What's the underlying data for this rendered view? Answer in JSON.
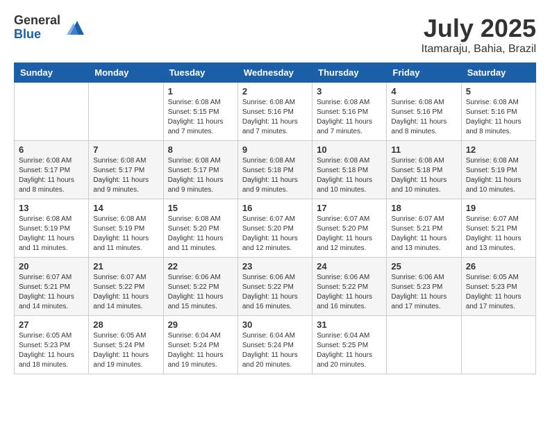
{
  "logo": {
    "general": "General",
    "blue": "Blue"
  },
  "title": {
    "month": "July 2025",
    "location": "Itamaraju, Bahia, Brazil"
  },
  "headers": [
    "Sunday",
    "Monday",
    "Tuesday",
    "Wednesday",
    "Thursday",
    "Friday",
    "Saturday"
  ],
  "weeks": [
    [
      {
        "day": "",
        "info": ""
      },
      {
        "day": "",
        "info": ""
      },
      {
        "day": "1",
        "info": "Sunrise: 6:08 AM\nSunset: 5:15 PM\nDaylight: 11 hours and 7 minutes."
      },
      {
        "day": "2",
        "info": "Sunrise: 6:08 AM\nSunset: 5:16 PM\nDaylight: 11 hours and 7 minutes."
      },
      {
        "day": "3",
        "info": "Sunrise: 6:08 AM\nSunset: 5:16 PM\nDaylight: 11 hours and 7 minutes."
      },
      {
        "day": "4",
        "info": "Sunrise: 6:08 AM\nSunset: 5:16 PM\nDaylight: 11 hours and 8 minutes."
      },
      {
        "day": "5",
        "info": "Sunrise: 6:08 AM\nSunset: 5:16 PM\nDaylight: 11 hours and 8 minutes."
      }
    ],
    [
      {
        "day": "6",
        "info": "Sunrise: 6:08 AM\nSunset: 5:17 PM\nDaylight: 11 hours and 8 minutes."
      },
      {
        "day": "7",
        "info": "Sunrise: 6:08 AM\nSunset: 5:17 PM\nDaylight: 11 hours and 9 minutes."
      },
      {
        "day": "8",
        "info": "Sunrise: 6:08 AM\nSunset: 5:17 PM\nDaylight: 11 hours and 9 minutes."
      },
      {
        "day": "9",
        "info": "Sunrise: 6:08 AM\nSunset: 5:18 PM\nDaylight: 11 hours and 9 minutes."
      },
      {
        "day": "10",
        "info": "Sunrise: 6:08 AM\nSunset: 5:18 PM\nDaylight: 11 hours and 10 minutes."
      },
      {
        "day": "11",
        "info": "Sunrise: 6:08 AM\nSunset: 5:18 PM\nDaylight: 11 hours and 10 minutes."
      },
      {
        "day": "12",
        "info": "Sunrise: 6:08 AM\nSunset: 5:19 PM\nDaylight: 11 hours and 10 minutes."
      }
    ],
    [
      {
        "day": "13",
        "info": "Sunrise: 6:08 AM\nSunset: 5:19 PM\nDaylight: 11 hours and 11 minutes."
      },
      {
        "day": "14",
        "info": "Sunrise: 6:08 AM\nSunset: 5:19 PM\nDaylight: 11 hours and 11 minutes."
      },
      {
        "day": "15",
        "info": "Sunrise: 6:08 AM\nSunset: 5:20 PM\nDaylight: 11 hours and 11 minutes."
      },
      {
        "day": "16",
        "info": "Sunrise: 6:07 AM\nSunset: 5:20 PM\nDaylight: 11 hours and 12 minutes."
      },
      {
        "day": "17",
        "info": "Sunrise: 6:07 AM\nSunset: 5:20 PM\nDaylight: 11 hours and 12 minutes."
      },
      {
        "day": "18",
        "info": "Sunrise: 6:07 AM\nSunset: 5:21 PM\nDaylight: 11 hours and 13 minutes."
      },
      {
        "day": "19",
        "info": "Sunrise: 6:07 AM\nSunset: 5:21 PM\nDaylight: 11 hours and 13 minutes."
      }
    ],
    [
      {
        "day": "20",
        "info": "Sunrise: 6:07 AM\nSunset: 5:21 PM\nDaylight: 11 hours and 14 minutes."
      },
      {
        "day": "21",
        "info": "Sunrise: 6:07 AM\nSunset: 5:22 PM\nDaylight: 11 hours and 14 minutes."
      },
      {
        "day": "22",
        "info": "Sunrise: 6:06 AM\nSunset: 5:22 PM\nDaylight: 11 hours and 15 minutes."
      },
      {
        "day": "23",
        "info": "Sunrise: 6:06 AM\nSunset: 5:22 PM\nDaylight: 11 hours and 16 minutes."
      },
      {
        "day": "24",
        "info": "Sunrise: 6:06 AM\nSunset: 5:22 PM\nDaylight: 11 hours and 16 minutes."
      },
      {
        "day": "25",
        "info": "Sunrise: 6:06 AM\nSunset: 5:23 PM\nDaylight: 11 hours and 17 minutes."
      },
      {
        "day": "26",
        "info": "Sunrise: 6:05 AM\nSunset: 5:23 PM\nDaylight: 11 hours and 17 minutes."
      }
    ],
    [
      {
        "day": "27",
        "info": "Sunrise: 6:05 AM\nSunset: 5:23 PM\nDaylight: 11 hours and 18 minutes."
      },
      {
        "day": "28",
        "info": "Sunrise: 6:05 AM\nSunset: 5:24 PM\nDaylight: 11 hours and 19 minutes."
      },
      {
        "day": "29",
        "info": "Sunrise: 6:04 AM\nSunset: 5:24 PM\nDaylight: 11 hours and 19 minutes."
      },
      {
        "day": "30",
        "info": "Sunrise: 6:04 AM\nSunset: 5:24 PM\nDaylight: 11 hours and 20 minutes."
      },
      {
        "day": "31",
        "info": "Sunrise: 6:04 AM\nSunset: 5:25 PM\nDaylight: 11 hours and 20 minutes."
      },
      {
        "day": "",
        "info": ""
      },
      {
        "day": "",
        "info": ""
      }
    ]
  ]
}
